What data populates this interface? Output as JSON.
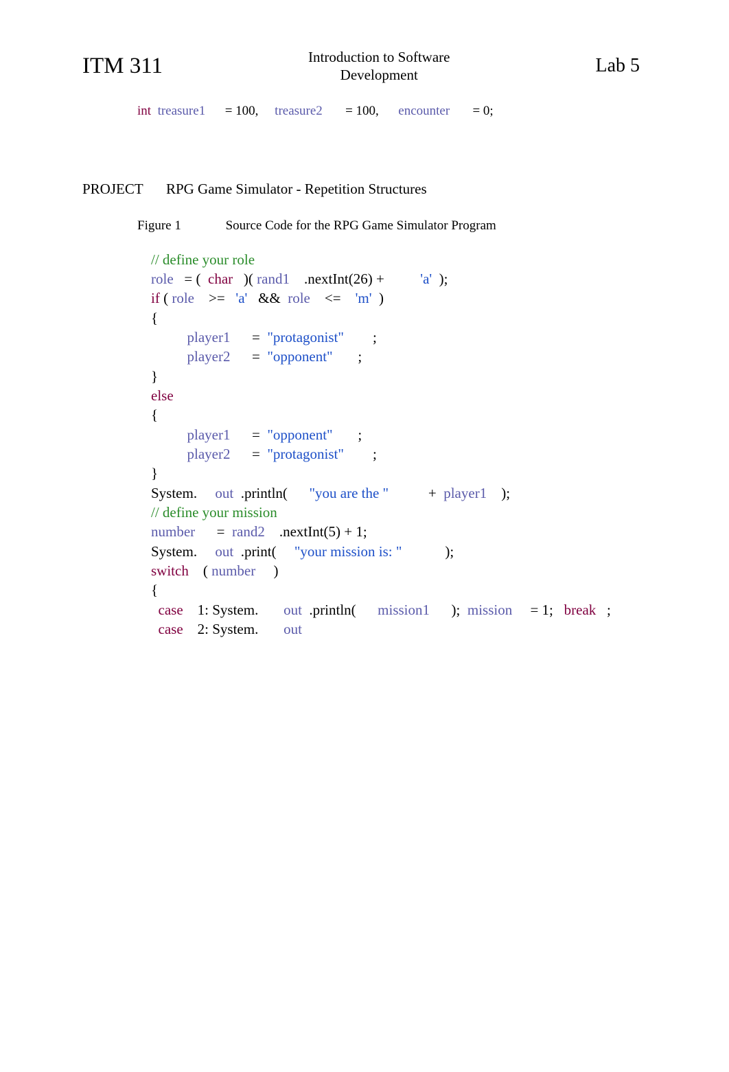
{
  "header": {
    "course_code": "ITM 311",
    "course_title_line1": "Introduction to Software",
    "course_title_line2": "Development",
    "lab_label": "Lab 5"
  },
  "decl": {
    "kw_int": "int",
    "var_t1": "treasure1",
    "assign": "=",
    "val_100a": "100,",
    "var_t2": "treasure2",
    "val_100b": "100,",
    "var_enc": "encounter",
    "val_0": "0;"
  },
  "section": {
    "label": "PROJECT",
    "title": "RPG Game Simulator - Repetition Structures"
  },
  "figure": {
    "label": "Figure 1",
    "caption": "Source Code for the RPG Game Simulator Program"
  },
  "code": {
    "c01_comment": "// define your role",
    "c02_role": "role",
    "c02_eq": "= (",
    "c02_char": "char",
    "c02_paren": ")(",
    "c02_rand1": "rand1",
    "c02_next": ".nextInt(26) +",
    "c02_a": "'a'",
    "c02_end": ");",
    "c03_if": "if",
    "c03_open": "(",
    "c03_role": "role",
    "c03_ge": ">=",
    "c03_a": "'a'",
    "c03_and": "&&",
    "c03_role2": "role",
    "c03_le": "<=",
    "c03_m": "'m'",
    "c03_close": ")",
    "c04_lb": "{",
    "c05_p1": "player1",
    "c05_eq": "=",
    "c05_prot": "\"protagonist\"",
    "c05_semi": ";",
    "c06_p2": "player2",
    "c06_eq": "=",
    "c06_opp": "\"opponent\"",
    "c06_semi": ";",
    "c07_rb": "}",
    "c08_else": "else",
    "c09_lb": "{",
    "c10_p1": "player1",
    "c10_eq": "=",
    "c10_opp": "\"opponent\"",
    "c10_semi": ";",
    "c11_p2": "player2",
    "c11_eq": "=",
    "c11_prot": "\"protagonist\"",
    "c11_semi": ";",
    "c12_rb": "}",
    "c13_sys": "System.",
    "c13_out": "out",
    "c13_println": ".println(",
    "c13_str": "\"you are the \"",
    "c13_plus": "+",
    "c13_p1": "player1",
    "c13_end": ");",
    "c14_comment": "// define your mission",
    "c15_num": "number",
    "c15_eq": "=",
    "c15_rand2": "rand2",
    "c15_next": ".nextInt(5) + 1;",
    "c16_sys": "System.",
    "c16_out": "out",
    "c16_print": ".print(",
    "c16_str": "\"your mission is: \"",
    "c16_end": ");",
    "c17_switch": "switch",
    "c17_open": "(",
    "c17_num": "number",
    "c17_close": ")",
    "c18_lb": "{",
    "c19_case": "case",
    "c19_1": "1: System.",
    "c19_out": "out",
    "c19_println": ".println(",
    "c19_m1": "mission1",
    "c19_paren": ");",
    "c19_mission": "mission",
    "c19_eq1": "= 1;",
    "c19_break": "break",
    "c19_semi": ";",
    "c20_case": "case",
    "c20_2": "2: System.",
    "c20_out": "out"
  }
}
